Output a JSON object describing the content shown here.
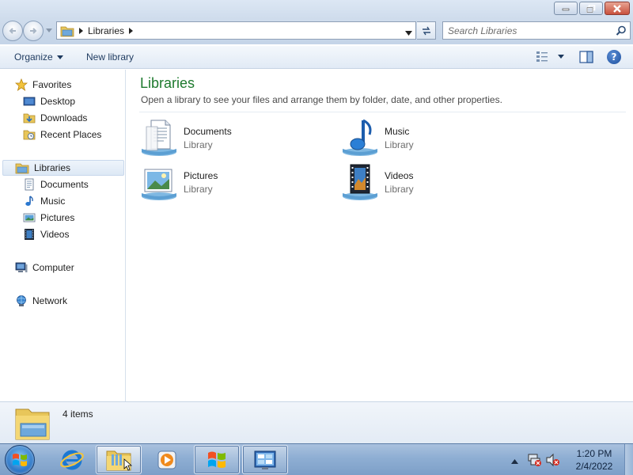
{
  "window": {
    "address": {
      "breadcrumb": [
        "Libraries"
      ]
    },
    "search": {
      "placeholder": "Search Libraries"
    },
    "toolbar": {
      "organize_label": "Organize",
      "new_library_label": "New library"
    },
    "nav": {
      "favorites": {
        "label": "Favorites",
        "items": [
          {
            "label": "Desktop",
            "icon": "desktop-icon"
          },
          {
            "label": "Downloads",
            "icon": "downloads-folder-icon"
          },
          {
            "label": "Recent Places",
            "icon": "recent-places-icon"
          }
        ]
      },
      "libraries": {
        "label": "Libraries",
        "items": [
          {
            "label": "Documents",
            "icon": "documents-icon"
          },
          {
            "label": "Music",
            "icon": "music-icon"
          },
          {
            "label": "Pictures",
            "icon": "pictures-icon"
          },
          {
            "label": "Videos",
            "icon": "videos-icon"
          }
        ]
      },
      "computer": {
        "label": "Computer"
      },
      "network": {
        "label": "Network"
      }
    },
    "content": {
      "title": "Libraries",
      "subtitle": "Open a library to see your files and arrange them by folder, date, and other properties.",
      "libraries": [
        {
          "name": "Documents",
          "type": "Library"
        },
        {
          "name": "Music",
          "type": "Library"
        },
        {
          "name": "Pictures",
          "type": "Library"
        },
        {
          "name": "Videos",
          "type": "Library"
        }
      ]
    },
    "details": {
      "count": "4 items"
    }
  },
  "taskbar": {
    "apps": [
      "internet-explorer-icon",
      "windows-explorer-icon",
      "media-player-icon",
      "windows-logo-icon",
      "control-panel-icon"
    ],
    "clock": {
      "time": "1:20 PM",
      "date": "2/4/2022"
    }
  },
  "colors": {
    "title_green": "#1e7a2e",
    "chrome_blue": "#c4d4e8",
    "taskbar_blue": "#8eaed3"
  }
}
